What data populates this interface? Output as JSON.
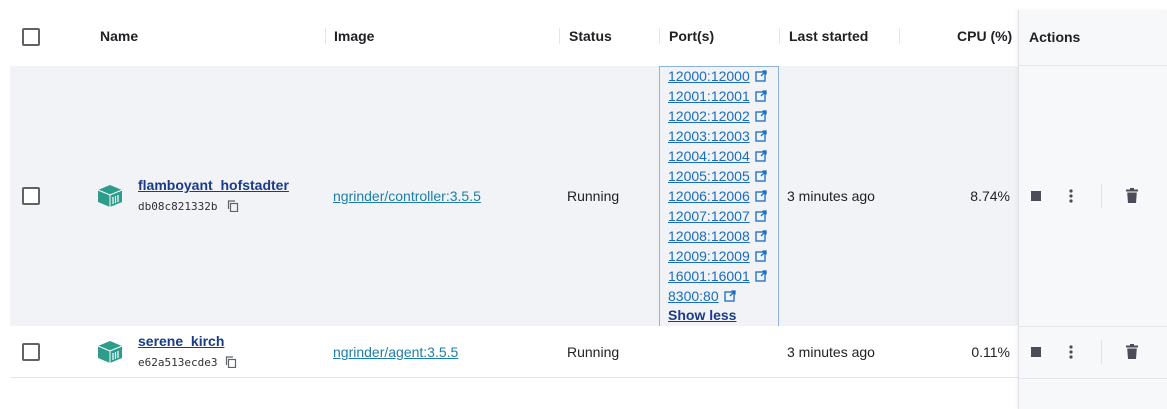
{
  "table": {
    "headers": {
      "name": "Name",
      "image": "Image",
      "status": "Status",
      "ports": "Port(s)",
      "last_started": "Last started",
      "cpu": "CPU (%)",
      "actions": "Actions"
    },
    "rows": [
      {
        "name": "flamboyant_hofstadter",
        "id": "db08c821332b",
        "image": "ngrinder/controller:3.5.5",
        "status": "Running",
        "ports": [
          "12000:12000",
          "12001:12001",
          "12002:12002",
          "12003:12003",
          "12004:12004",
          "12005:12005",
          "12006:12006",
          "12007:12007",
          "12008:12008",
          "12009:12009",
          "16001:16001",
          "8300:80"
        ],
        "show_less": "Show less",
        "last_started": "3 minutes ago",
        "cpu": "8.74%"
      },
      {
        "name": "serene_kirch",
        "id": "e62a513ecde3",
        "image": "ngrinder/agent:3.5.5",
        "status": "Running",
        "last_started": "3 minutes ago",
        "cpu": "0.11%"
      }
    ]
  },
  "colors": {
    "container_icon": "#2e9c8a",
    "link": "#1a6cc2",
    "name_link": "#1a3a8a",
    "selected_row": "#f1f3f6"
  },
  "icons": {
    "container": "container-icon",
    "copy": "copy-icon",
    "external": "external-link-icon",
    "stop": "stop-icon",
    "more": "more-vertical-icon",
    "delete": "trash-icon"
  }
}
